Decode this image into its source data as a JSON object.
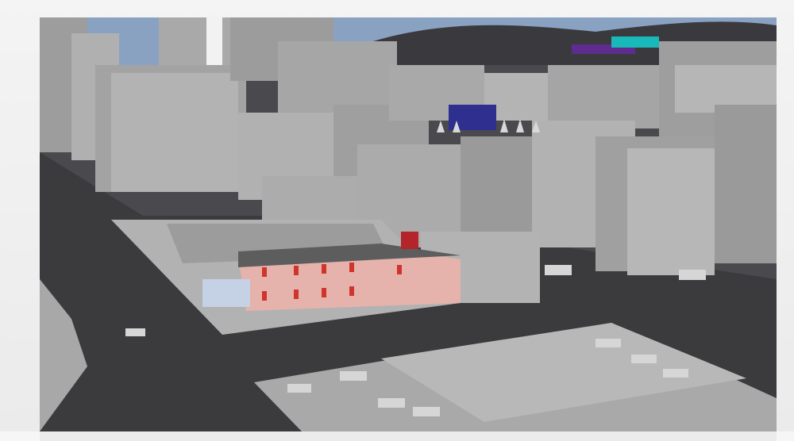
{
  "scene": {
    "kind": "3d-viewport-render",
    "palette": {
      "sky": "#8aa2c2",
      "hills": "#3a3a3e",
      "ground": "#3b3b3e",
      "building": "#a7a7a7",
      "building_shadow": "#8f8f8f",
      "motel_wall": "#e5b3ac",
      "motel_roof": "#5d5d5d",
      "motel_door": "#d0342c",
      "sign": "#b3242b",
      "blue_building": "#2e2f8f",
      "purple_train": "#5e2c8f",
      "teal_accent": "#19b9b9"
    }
  }
}
